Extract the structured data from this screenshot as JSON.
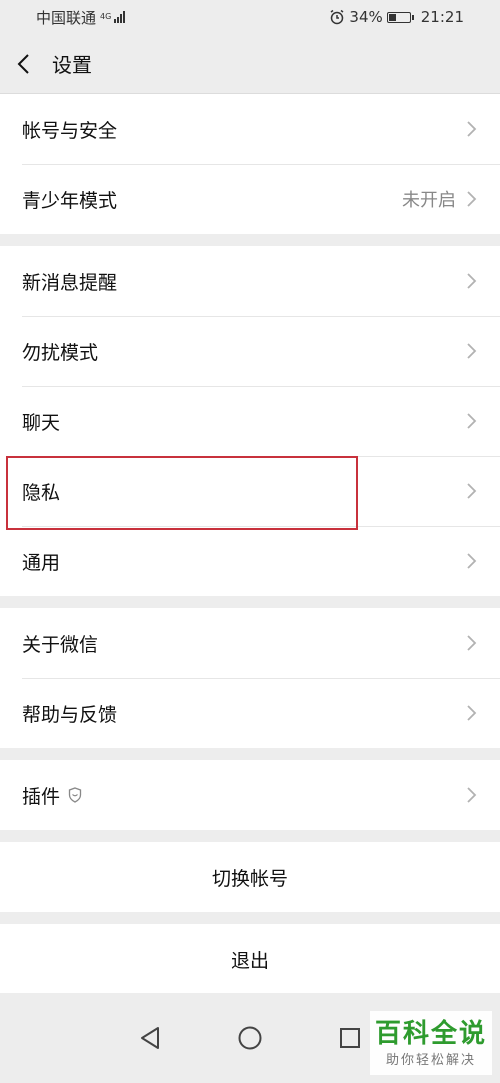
{
  "status": {
    "carrier": "中国联通",
    "network": "4G",
    "battery": "34%",
    "battery_level": 0.34,
    "time": "21:21"
  },
  "nav": {
    "title": "设置"
  },
  "groups": [
    {
      "items": [
        {
          "label": "帐号与安全",
          "value": ""
        },
        {
          "label": "青少年模式",
          "value": "未开启"
        }
      ]
    },
    {
      "items": [
        {
          "label": "新消息提醒",
          "value": ""
        },
        {
          "label": "勿扰模式",
          "value": ""
        },
        {
          "label": "聊天",
          "value": ""
        },
        {
          "label": "隐私",
          "value": ""
        },
        {
          "label": "通用",
          "value": ""
        }
      ]
    },
    {
      "items": [
        {
          "label": "关于微信",
          "value": ""
        },
        {
          "label": "帮助与反馈",
          "value": ""
        }
      ]
    },
    {
      "items": [
        {
          "label": "插件",
          "value": ""
        }
      ]
    }
  ],
  "actions": {
    "switch_account": "切换帐号",
    "logout": "退出"
  },
  "watermark": {
    "main": "百科全说",
    "sub": "助你轻松解决"
  },
  "colors": {
    "highlight": "#c8313c",
    "watermark": "#2e9b2e"
  }
}
